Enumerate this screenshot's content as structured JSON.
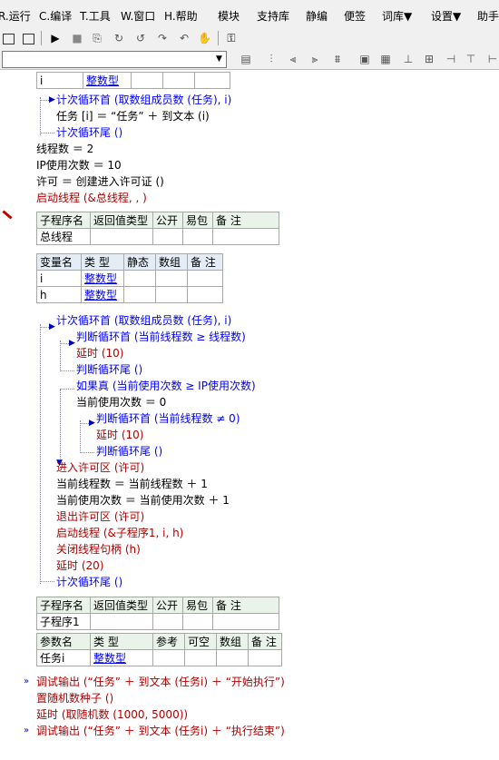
{
  "menu": [
    "R.运行",
    "C.编译",
    "T.工具",
    "W.窗口",
    "H.帮助",
    "模块",
    "支持库",
    "静编",
    "便签",
    "词库▼",
    "设置▼",
    "助手"
  ],
  "combo": {
    "value": ""
  },
  "code": {
    "top_row": {
      "name": "i",
      "type": "整数型"
    },
    "loop1_head": "计次循环首 (取数组成员数 (任务), i)",
    "loop1_body": "任务 [i] ＝ “任务” ＋ 到文本 (i)",
    "loop1_tail": "计次循环尾 ()",
    "line_threads": "线程数 ＝ 2",
    "line_ipcount": "IP使用次数 ＝ 10",
    "line_permit": "许可 ＝ 创建进入许可证 ()",
    "line_start": "启动线程 (&总线程, , )",
    "sub1_header": [
      "子程序名",
      "返回值类型",
      "公开",
      "易包",
      "备 注"
    ],
    "sub1_name": "总线程",
    "var_header": [
      "变量名",
      "类 型",
      "静态",
      "数组",
      "备 注"
    ],
    "var_rows": [
      {
        "name": "i",
        "type": "整数型"
      },
      {
        "name": "h",
        "type": "整数型"
      }
    ],
    "loop2_head": "计次循环首 (取数组成员数 (任务), i)",
    "judge1_head": "判断循环首 (当前线程数 ≥ 线程数)",
    "delay1": "延时 (10)",
    "judge1_tail": "判断循环尾 ()",
    "if_head": "如果真 (当前使用次数 ≥ IP使用次数)",
    "set_used": "当前使用次数 ＝ 0",
    "judge2_head": "判断循环首 (当前线程数 ≠ 0)",
    "delay2": "延时 (10)",
    "judge2_tail": "判断循环尾 ()",
    "enter": "进入许可区 (许可)",
    "inc_threads": "当前线程数 ＝ 当前线程数 ＋ 1",
    "inc_used": "当前使用次数 ＝ 当前使用次数 ＋ 1",
    "leave": "退出许可区 (许可)",
    "start_sub": "启动线程 (&子程序1, i, h)",
    "close_handle": "关闭线程句柄 (h)",
    "delay3": "延时 (20)",
    "loop2_tail": "计次循环尾 ()",
    "sub2_header": [
      "子程序名",
      "返回值类型",
      "公开",
      "易包",
      "备 注"
    ],
    "sub2_name": "子程序1",
    "param_header": [
      "参数名",
      "类 型",
      "参考",
      "可空",
      "数组",
      "备 注"
    ],
    "param_row": {
      "name": "任务i",
      "type": "整数型"
    },
    "debug1": "调试输出 (“任务” ＋ 到文本 (任务i) ＋ “开始执行”)",
    "random_seed": "置随机数种子 ()",
    "delay_rand": "延时 (取随机数 (1000, 5000))",
    "debug2": "调试输出 (“任务” ＋ 到文本 (任务i) ＋ “执行结束”)"
  }
}
